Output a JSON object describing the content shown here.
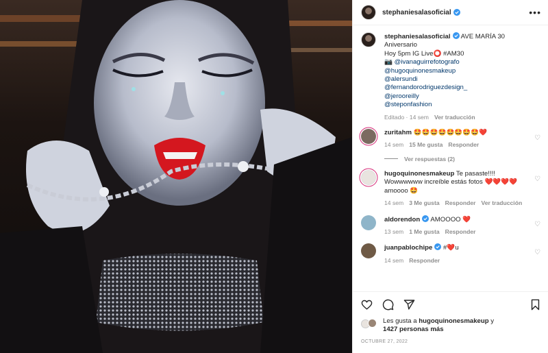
{
  "post": {
    "username": "stephaniesalasoficial",
    "caption_lines": [
      "AVE MARÍA 30",
      "Aniversario",
      "Hoy 5pm IG Live⭕ #AM30",
      "📷 @ivanaguirrefotografo",
      "@hugoquinonesmakeup",
      "@alersundi",
      "@fernandorodriguezdesign_",
      "@jerooreilly",
      "@steponfashion"
    ],
    "caption_meta": {
      "edited": "Editado · 14 sem",
      "translate": "Ver traducción"
    }
  },
  "comments": [
    {
      "user": "zuritahm",
      "text": "🤩🤩🤩🤩🤩🤩🤩🤩❤️",
      "time": "14 sem",
      "likes": "15 Me gusta",
      "reply": "Responder",
      "translate": "",
      "avatar_color": "#7b6a60",
      "replies_label": "Ver respuestas (2)"
    },
    {
      "user": "hugoquinonesmakeup",
      "text": "Te pasaste!!!! Wowwwwww increíble estás fotos ❤️❤️❤️❤️ amoooo 🤩",
      "time": "14 sem",
      "likes": "3 Me gusta",
      "reply": "Responder",
      "translate": "Ver traducción",
      "avatar_color": "#e9e4df"
    },
    {
      "user": "aldorendon",
      "text": "AMOOOO ❤️",
      "time": "13 sem",
      "likes": "1 Me gusta",
      "reply": "Responder",
      "translate": "",
      "avatar_color": "#8fb5c9"
    },
    {
      "user": "juanpablochipe",
      "text": "#❤️u",
      "time": "14 sem",
      "likes": "",
      "reply": "Responder",
      "translate": "",
      "avatar_color": "#6f5a46"
    }
  ],
  "likes": {
    "prefix": "Les gusta a ",
    "user": "hugoquinonesmakeup",
    "middle": " y",
    "count": "1427 personas más"
  },
  "date": "OCTUBRE 27, 2022",
  "icons": {
    "more": "more-options-icon",
    "like": "heart-icon",
    "comment": "comment-icon",
    "share": "share-icon",
    "save": "bookmark-icon",
    "verified": "verified-badge-icon"
  },
  "colors": {
    "verified": "#3897f0",
    "link": "#00376b",
    "heart": "#ed4956"
  }
}
